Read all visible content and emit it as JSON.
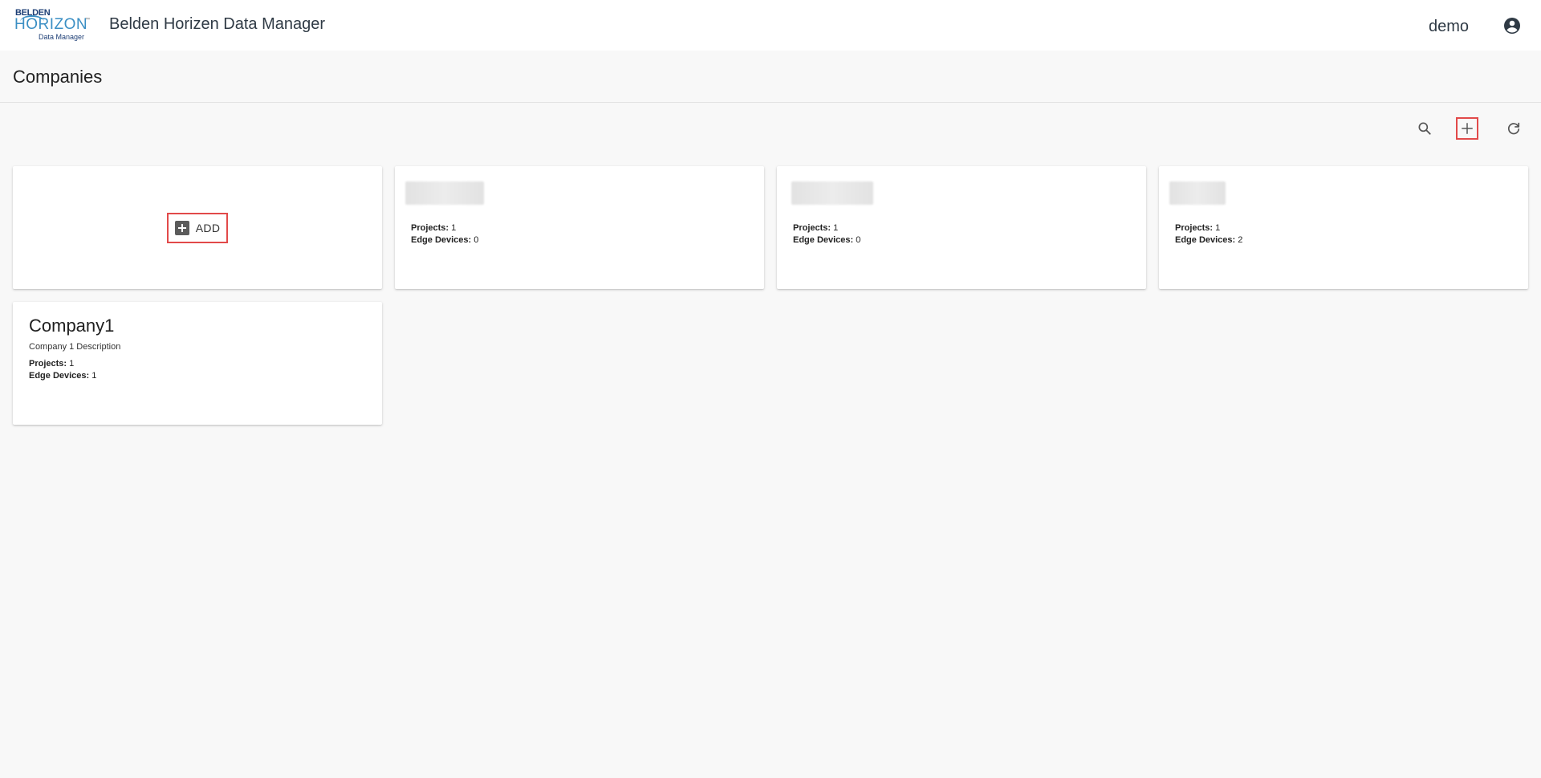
{
  "header": {
    "logo": {
      "brand_top": "BELDEN",
      "brand_main": "HORIZON",
      "brand_tm": "™",
      "brand_sub": "Data Manager"
    },
    "app_title": "Belden Horizen Data Manager",
    "user_name": "demo",
    "account_icon": "account-circle-icon"
  },
  "page": {
    "title": "Companies"
  },
  "toolbar": {
    "search_icon": "search-icon",
    "add_icon": "plus-icon",
    "refresh_icon": "refresh-icon"
  },
  "add_card": {
    "label": "ADD",
    "icon": "add-box-icon"
  },
  "companies": [
    {
      "name": "",
      "description": "",
      "projects_label": "Projects:",
      "projects": "1",
      "edge_devices_label": "Edge Devices:",
      "edge_devices": "0"
    },
    {
      "name": "",
      "description": "",
      "projects_label": "Projects:",
      "projects": "1",
      "edge_devices_label": "Edge Devices:",
      "edge_devices": "0"
    },
    {
      "name": "",
      "description": "",
      "projects_label": "Projects:",
      "projects": "1",
      "edge_devices_label": "Edge Devices:",
      "edge_devices": "2"
    },
    {
      "name": "Company1",
      "description": "Company 1 Description",
      "projects_label": "Projects:",
      "projects": "1",
      "edge_devices_label": "Edge Devices:",
      "edge_devices": "1"
    }
  ],
  "colors": {
    "highlight": "#e24a4a",
    "logo_dark": "#1e3f76",
    "logo_light": "#3b8fc4",
    "background": "#f8f8f8"
  }
}
